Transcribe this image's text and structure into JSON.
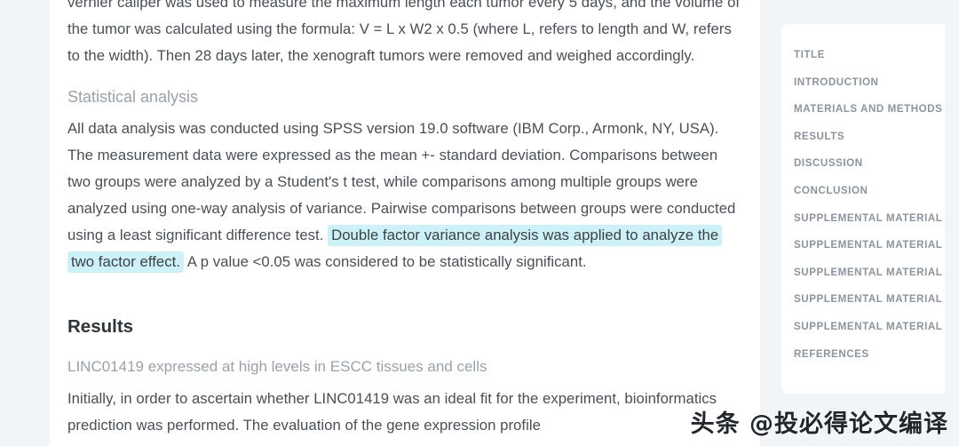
{
  "article": {
    "paragraph_methods_partial": "vernier caliper was used to measure the maximum length each tumor every 5 days, and the volume of the tumor was calculated using the formula: V = L x W2 x 0.5 (where L, refers to length and W, refers to the width). Then 28 days later, the xenograft tumors were removed and weighed accordingly.",
    "statistical_heading": "Statistical analysis",
    "statistical_before_highlight": "All data analysis was conducted using SPSS version 19.0 software (IBM Corp., Armonk, NY, USA). The measurement data were expressed as the mean +- standard deviation. Comparisons between two groups were analyzed by a Student's t test, while comparisons among multiple groups were analyzed using one-way analysis of variance. Pairwise comparisons between groups were conducted using a least significant difference test. ",
    "highlighted_sentence": "Double factor variance analysis was applied to analyze the two factor effect.",
    "statistical_after_highlight": " A p value <0.05 was considered to be statistically significant.",
    "results_heading": "Results",
    "results_subheading": "LINC01419 expressed at high levels in ESCC tissues and cells",
    "results_paragraph": "Initially, in order to ascertain whether LINC01419 was an ideal fit for the experiment, bioinformatics prediction was performed. The evaluation of the gene expression profile"
  },
  "sidebar": {
    "items": [
      {
        "label": "TITLE"
      },
      {
        "label": "INTRODUCTION"
      },
      {
        "label": "MATERIALS AND METHODS"
      },
      {
        "label": "RESULTS"
      },
      {
        "label": "DISCUSSION"
      },
      {
        "label": "CONCLUSION"
      },
      {
        "label": "SUPPLEMENTAL MATERIAL"
      },
      {
        "label": "SUPPLEMENTAL MATERIAL"
      },
      {
        "label": "SUPPLEMENTAL MATERIAL"
      },
      {
        "label": "SUPPLEMENTAL MATERIAL"
      },
      {
        "label": "SUPPLEMENTAL MATERIAL"
      },
      {
        "label": "REFERENCES"
      }
    ]
  },
  "watermark": {
    "text": "头条 @投必得论文编译"
  },
  "colors": {
    "page_background": "#f2f5f8",
    "content_background": "#ffffff",
    "body_text": "#4a4f55",
    "muted_text": "#9aa1a9",
    "heading_text": "#2f3438",
    "highlight": "#cdf1f6",
    "nav_text": "#8c949d"
  }
}
